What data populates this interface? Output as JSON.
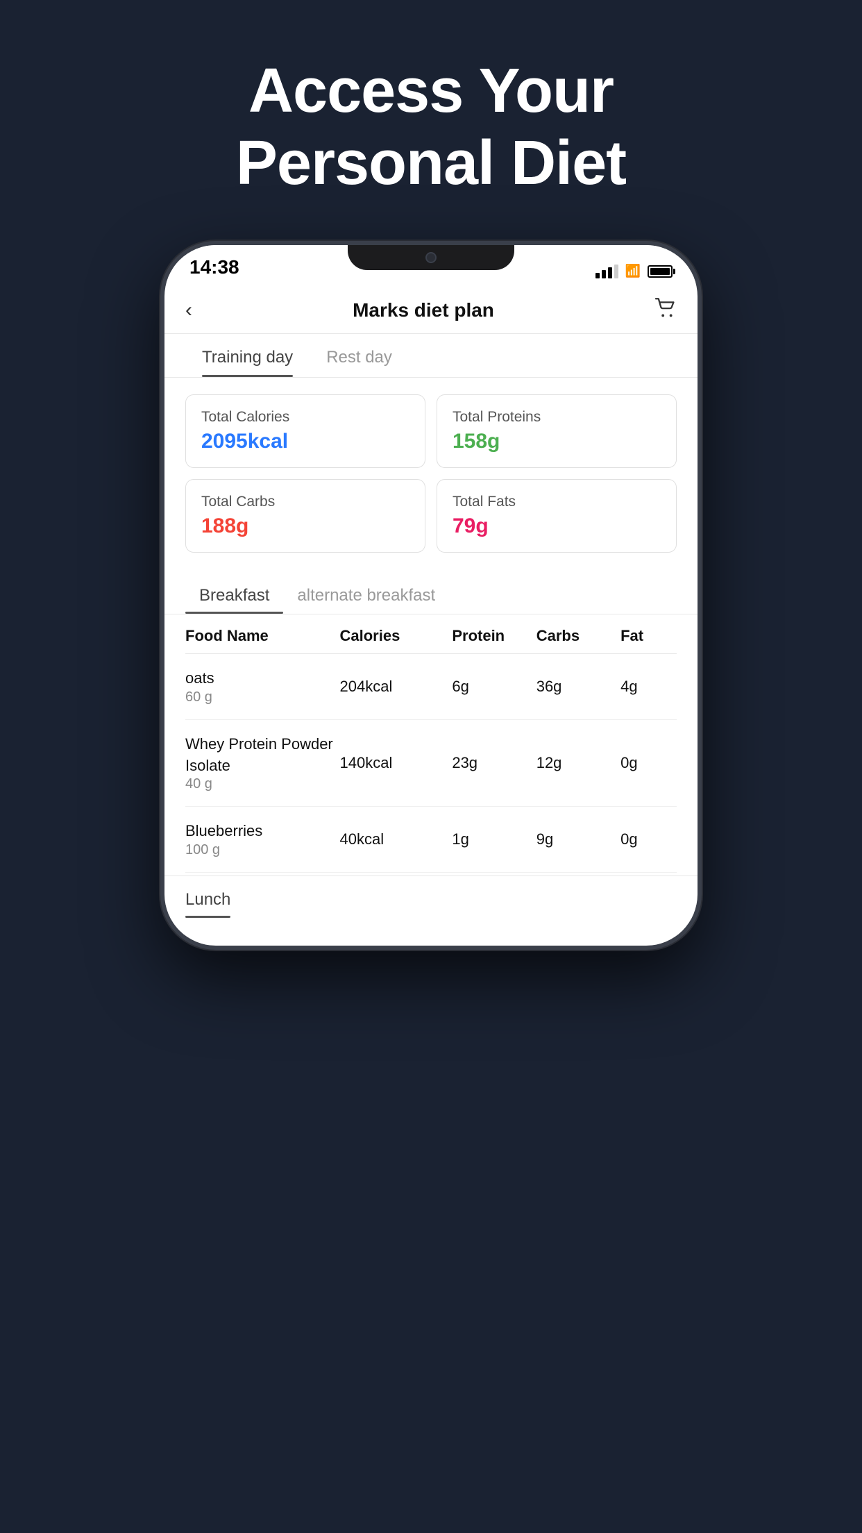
{
  "hero": {
    "title_line1": "Access Your",
    "title_line2": "Personal Diet"
  },
  "status_bar": {
    "time": "14:38"
  },
  "nav": {
    "title": "Marks diet plan",
    "back_label": "<",
    "cart_label": "🛒"
  },
  "day_tabs": [
    {
      "label": "Training day",
      "active": true
    },
    {
      "label": "Rest day",
      "active": false
    }
  ],
  "stats": [
    {
      "label": "Total Calories",
      "value": "2095kcal",
      "color_class": "calories"
    },
    {
      "label": "Total Proteins",
      "value": "158g",
      "color_class": "protein"
    },
    {
      "label": "Total Carbs",
      "value": "188g",
      "color_class": "carbs"
    },
    {
      "label": "Total Fats",
      "value": "79g",
      "color_class": "fats"
    }
  ],
  "meal_tabs": [
    {
      "label": "Breakfast",
      "active": true
    },
    {
      "label": "alternate breakfast",
      "active": false
    }
  ],
  "table_headers": [
    "Food Name",
    "Calories",
    "Protein",
    "Carbs",
    "Fat"
  ],
  "food_rows": [
    {
      "name": "oats",
      "weight": "60 g",
      "calories": "204kcal",
      "protein": "6g",
      "carbs": "36g",
      "fat": "4g"
    },
    {
      "name": "Whey Protein Powder Isolate",
      "weight": "40 g",
      "calories": "140kcal",
      "protein": "23g",
      "carbs": "12g",
      "fat": "0g"
    },
    {
      "name": "Blueberries",
      "weight": "100 g",
      "calories": "40kcal",
      "protein": "1g",
      "carbs": "9g",
      "fat": "0g"
    }
  ],
  "lunch_tab": {
    "label": "Lunch",
    "active": true
  },
  "colors": {
    "background": "#1a2232",
    "phone_bg": "#ffffff",
    "calories_color": "#2979ff",
    "protein_color": "#4caf50",
    "carbs_color": "#f44336",
    "fats_color": "#e91e63"
  }
}
